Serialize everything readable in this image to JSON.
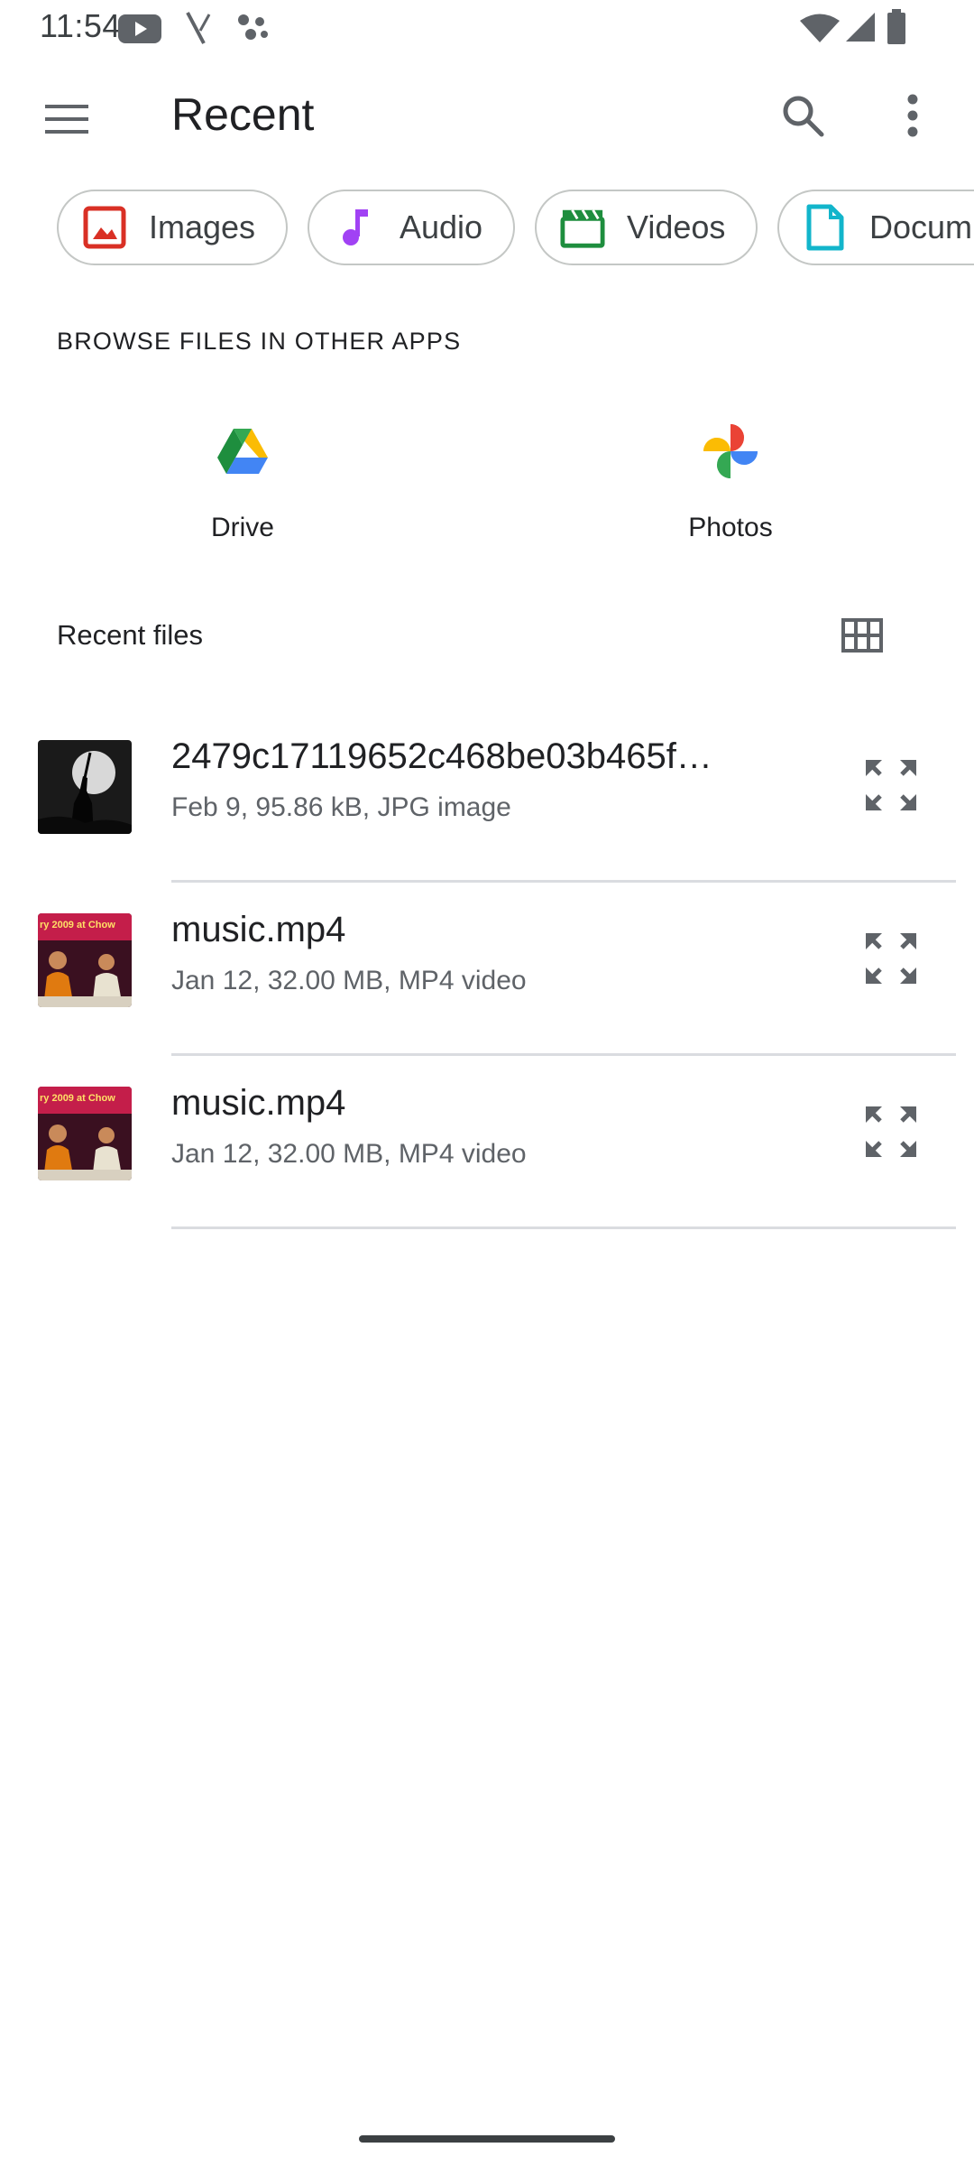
{
  "status_bar": {
    "time": "11:54",
    "icons": [
      "youtube-icon",
      "signal-slash-icon",
      "dots-icon",
      "wifi-icon",
      "cell-signal-icon",
      "battery-icon"
    ]
  },
  "app_bar": {
    "title": "Recent",
    "icons": [
      "menu-icon",
      "search-icon",
      "more-vert-icon"
    ]
  },
  "chips": [
    {
      "label": "Images",
      "icon": "image-icon",
      "color": "#d93025"
    },
    {
      "label": "Audio",
      "icon": "music-note-icon",
      "color": "#a142f4"
    },
    {
      "label": "Videos",
      "icon": "clapperboard-icon",
      "color": "#1e8e3e"
    },
    {
      "label": "Docum",
      "icon": "document-icon",
      "color": "#12b5cb"
    }
  ],
  "browse_section": {
    "header": "BROWSE FILES IN OTHER APPS",
    "apps": [
      {
        "label": "Drive",
        "icon": "google-drive-icon"
      },
      {
        "label": "Photos",
        "icon": "google-photos-icon"
      }
    ]
  },
  "recent_files": {
    "header": "Recent files",
    "view_toggle_icon": "grid-view-icon",
    "items": [
      {
        "name": "2479c17119652c468be03b465f…",
        "meta": "Feb 9, 95.86 kB, JPG image",
        "thumbnail": "moon-silhouette-thumbnail"
      },
      {
        "name": "music.mp4",
        "meta": "Jan 12, 32.00 MB, MP4 video",
        "thumbnail": "concert-video-thumbnail",
        "thumb_text": "ry 2009 at Chow"
      },
      {
        "name": "music.mp4",
        "meta": "Jan 12, 32.00 MB, MP4 video",
        "thumbnail": "concert-video-thumbnail",
        "thumb_text": "ry 2009 at Chow"
      }
    ]
  }
}
